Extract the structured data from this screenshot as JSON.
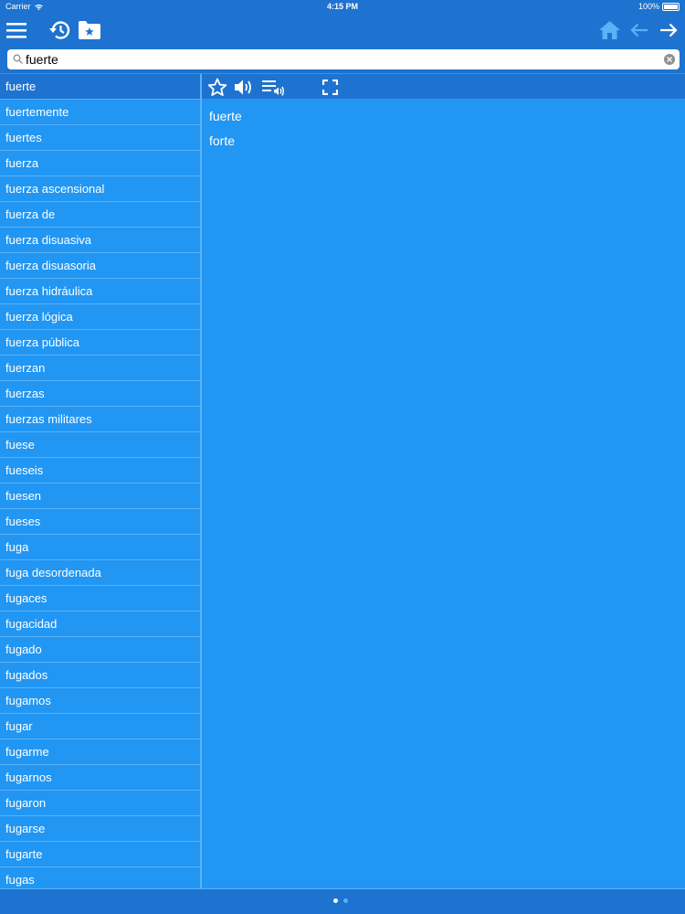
{
  "status": {
    "carrier": "Carrier",
    "time": "4:15 PM",
    "battery": "100%"
  },
  "toolbar": {
    "menu_icon": "hamburger-menu-icon",
    "history_icon": "history-icon",
    "favorites_icon": "favorites-folder-icon",
    "home_icon": "home-icon",
    "back_icon": "back-arrow-icon",
    "forward_icon": "forward-arrow-icon"
  },
  "search": {
    "value": "fuerte",
    "placeholder": ""
  },
  "wordlist": {
    "selected_index": 0,
    "items": [
      "fuerte",
      "fuertemente",
      "fuertes",
      "fuerza",
      "fuerza ascensional",
      "fuerza de",
      "fuerza disuasiva",
      "fuerza disuasoria",
      "fuerza hidráulica",
      "fuerza lógica",
      "fuerza pública",
      "fuerzan",
      "fuerzas",
      "fuerzas militares",
      "fuese",
      "fueseis",
      "fuesen",
      "fueses",
      "fuga",
      "fuga desordenada",
      "fugaces",
      "fugacidad",
      "fugado",
      "fugados",
      "fugamos",
      "fugar",
      "fugarme",
      "fugarnos",
      "fugaron",
      "fugarse",
      "fugarte",
      "fugas"
    ]
  },
  "detail_toolbar": {
    "favorite_icon": "star-icon",
    "speak_icon": "speaker-icon",
    "speak_list_icon": "playlist-speaker-icon",
    "fullscreen_icon": "fullscreen-icon"
  },
  "entry": {
    "headword": "fuerte",
    "translation": "forte"
  },
  "pager": {
    "pages": 2,
    "current": 1
  },
  "colors": {
    "bar": "#1E73D0",
    "background": "#2196F3",
    "separator": "#5AB2F7"
  }
}
